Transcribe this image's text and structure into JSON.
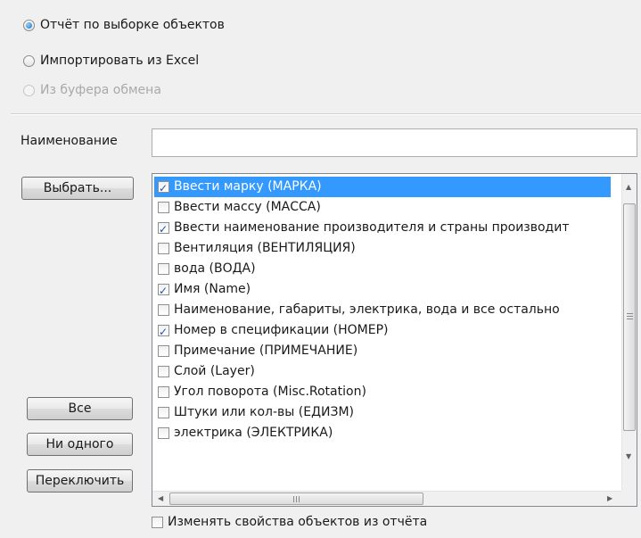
{
  "source_options": [
    {
      "label": "Отчёт по выборке объектов",
      "checked": true,
      "disabled": false
    },
    {
      "label": "Импортировать из Excel",
      "checked": false,
      "disabled": false
    },
    {
      "label": "Из буфера обмена",
      "checked": false,
      "disabled": true
    }
  ],
  "name_field": {
    "label": "Наименование",
    "value": ""
  },
  "buttons": {
    "select": "Выбрать...",
    "all": "Все",
    "none": "Ни одного",
    "toggle": "Переключить"
  },
  "properties": [
    {
      "label": "Ввести марку (МАРКА)",
      "checked": true,
      "selected": true
    },
    {
      "label": "Ввести массу (МАССА)",
      "checked": false,
      "selected": false
    },
    {
      "label": "Ввести наименование производителя и страны производит",
      "checked": true,
      "selected": false
    },
    {
      "label": "Вентиляция (ВЕНТИЛЯЦИЯ)",
      "checked": false,
      "selected": false
    },
    {
      "label": "вода (ВОДА)",
      "checked": false,
      "selected": false
    },
    {
      "label": "Имя (Name)",
      "checked": true,
      "selected": false
    },
    {
      "label": "Наименование, габариты, электрика, вода и все остально",
      "checked": false,
      "selected": false
    },
    {
      "label": "Номер в спецификации (НОМЕР)",
      "checked": true,
      "selected": false
    },
    {
      "label": "Примечание (ПРИМЕЧАНИЕ)",
      "checked": false,
      "selected": false
    },
    {
      "label": "Слой (Layer)",
      "checked": false,
      "selected": false
    },
    {
      "label": "Угол поворота (Misc.Rotation)",
      "checked": false,
      "selected": false
    },
    {
      "label": "Штуки или кол-вы (ЕДИЗМ)",
      "checked": false,
      "selected": false
    },
    {
      "label": "электрика (ЭЛЕКТРИКА)",
      "checked": false,
      "selected": false
    }
  ],
  "change_props": {
    "label": "Изменять свойства объектов из отчёта",
    "checked": false
  }
}
